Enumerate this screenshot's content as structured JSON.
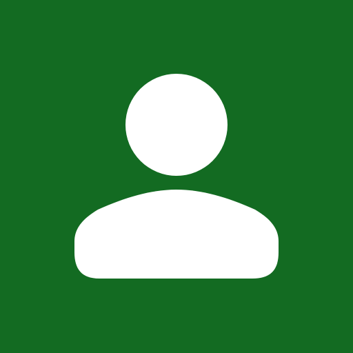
{
  "avatar": {
    "icon": "user-silhouette-icon",
    "background_color": "#136b22",
    "foreground_color": "#ffffff"
  }
}
